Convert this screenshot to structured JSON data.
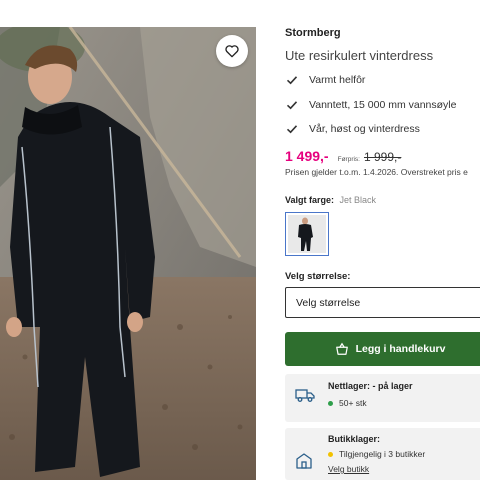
{
  "product": {
    "brand": "Stormberg",
    "title": "Ute resirkulert vinterdress",
    "image_alt": "Jet Black"
  },
  "features": [
    {
      "label": "Varmt helfôr",
      "icon": "check-icon"
    },
    {
      "label": "Vanntett, 15 000 mm vannsøyle",
      "icon": "check-icon"
    },
    {
      "label": "Vår, høst og vinterdress",
      "icon": "check-icon"
    }
  ],
  "pricing": {
    "price": "1 499,-",
    "was_label": "Førpris:",
    "was_price": "1 999,-",
    "note": "Prisen gjelder t.o.m. 1.4.2026. Overstreket pris e"
  },
  "color": {
    "label": "Valgt farge:",
    "value": "Jet Black"
  },
  "size": {
    "label": "Velg størrelse:",
    "placeholder": "Velg størrelse"
  },
  "cart": {
    "button_label": "Legg i handlekurv",
    "icon": "shopping-bag-icon"
  },
  "online_stock": {
    "title": "Nettlager: - på lager",
    "detail": "50+ stk",
    "icon": "delivery-truck-icon",
    "status_color": "#2e9e4a"
  },
  "store_stock": {
    "title": "Butikklager:",
    "detail": "Tilgjengelig i 3 butikker",
    "link": "Velg butikk",
    "icon": "store-icon",
    "status_color": "#f2c200"
  },
  "colors": {
    "price_accent": "#e6007e",
    "cart_button": "#2e6e2e",
    "swatch_border": "#4a76c9"
  }
}
